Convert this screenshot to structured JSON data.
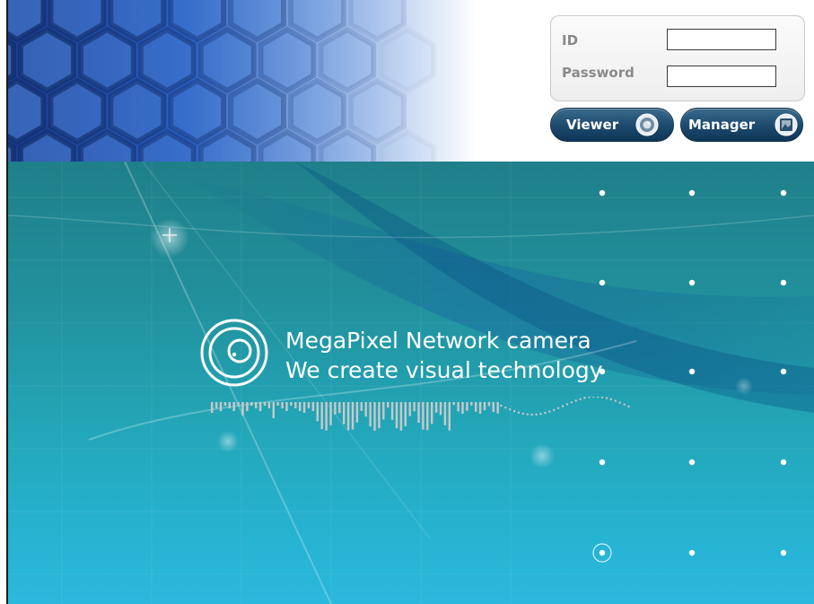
{
  "login": {
    "id_label": "ID",
    "password_label": "Password",
    "id_value": "",
    "password_value": ""
  },
  "buttons": {
    "viewer_label": "Viewer",
    "manager_label": "Manager"
  },
  "icons": {
    "viewer": "camera-lens-icon",
    "manager": "picture-icon",
    "logo": "camera-lens-logo-icon"
  },
  "tagline": {
    "line1": "MegaPixel Network camera",
    "line2": "We create visual technology"
  },
  "colors": {
    "button": "#1c4a6d",
    "teal_background": "#23a6b8",
    "banner_blue": "#2c63c5"
  }
}
